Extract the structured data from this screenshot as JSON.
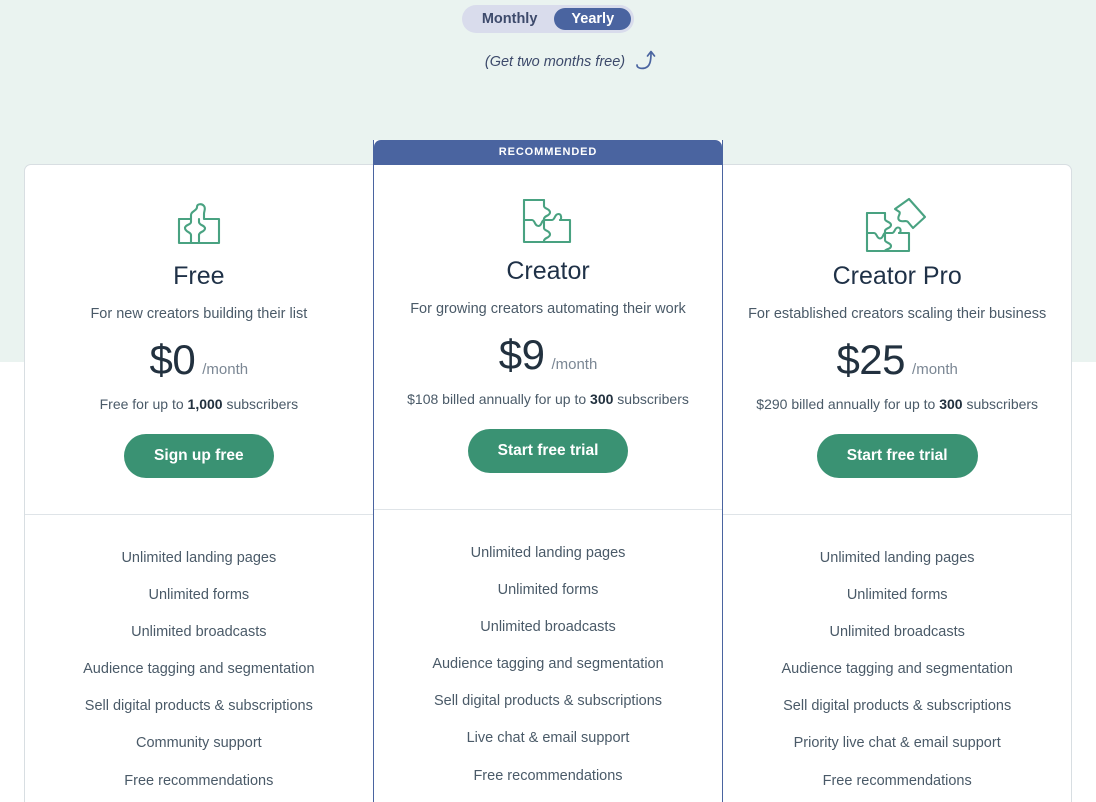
{
  "billing_toggle": {
    "options": [
      {
        "label": "Monthly",
        "active": false
      },
      {
        "label": "Yearly",
        "active": true
      }
    ],
    "note": "(Get two months free)",
    "arrow_icon": "curved-arrow-up-right-icon",
    "active_color": "#4a64a0",
    "track_color": "#d9dcec"
  },
  "theme": {
    "band_color": "#eaf3f0",
    "accent_blue": "#4a64a0",
    "cta_green": "#3a9273",
    "heading_color": "#1f3147",
    "body_text": "#4a5a68"
  },
  "ribbon": {
    "label": "RECOMMENDED"
  },
  "plans": [
    {
      "id": "free",
      "icon": "puzzle-one-piece-icon",
      "name": "Free",
      "tagline": "For new creators building their list",
      "price": "$0",
      "period": "/month",
      "billing_note_prefix": "Free for up to ",
      "billing_note_bold": "1,000",
      "billing_note_suffix": " subscribers",
      "cta_label": "Sign up free",
      "features": [
        "Unlimited landing pages",
        "Unlimited forms",
        "Unlimited broadcasts",
        "Audience tagging and segmentation",
        "Sell digital products & subscriptions",
        "Community support",
        "Free recommendations"
      ]
    },
    {
      "id": "creator",
      "icon": "puzzle-three-pieces-icon",
      "name": "Creator",
      "tagline": "For growing creators automating their work",
      "price": "$9",
      "period": "/month",
      "billing_note_prefix": "$108 billed annually for up to ",
      "billing_note_bold": "300",
      "billing_note_suffix": " subscribers",
      "cta_label": "Start free trial",
      "recommended": true,
      "features": [
        "Unlimited landing pages",
        "Unlimited forms",
        "Unlimited broadcasts",
        "Audience tagging and segmentation",
        "Sell digital products & subscriptions",
        "Live chat & email support",
        "Free recommendations"
      ]
    },
    {
      "id": "creator-pro",
      "icon": "puzzle-four-pieces-icon",
      "name": "Creator Pro",
      "tagline": "For established creators scaling their business",
      "price": "$25",
      "period": "/month",
      "billing_note_prefix": "$290 billed annually for up to ",
      "billing_note_bold": "300",
      "billing_note_suffix": " subscribers",
      "cta_label": "Start free trial",
      "features": [
        "Unlimited landing pages",
        "Unlimited forms",
        "Unlimited broadcasts",
        "Audience tagging and segmentation",
        "Sell digital products & subscriptions",
        "Priority live chat & email support",
        "Free recommendations"
      ]
    }
  ]
}
